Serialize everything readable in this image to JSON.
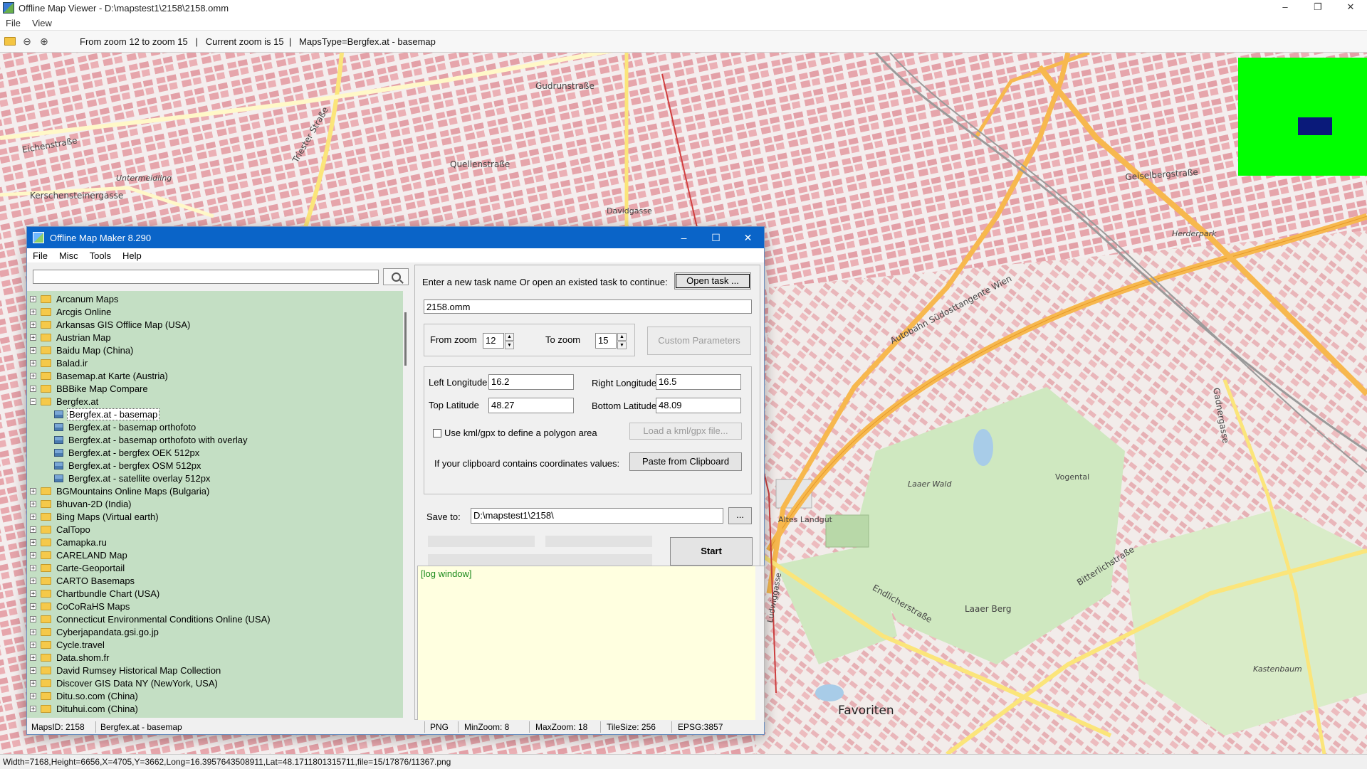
{
  "viewer": {
    "title": "Offline Map Viewer - D:\\mapstest1\\2158\\2158.omm",
    "menu": [
      "File",
      "View"
    ],
    "toolbar_status": "From zoom 12 to zoom 15   |   Current zoom is 15  |   MapsType=Bergfex.at - basemap",
    "status_bar": "Width=7168,Height=6656,X=4705,Y=3662,Long=16.3957643508911,Lat=48.1711801315711,file=15/17876/11367.png"
  },
  "map_labels": [
    "Favoriten",
    "Gudrunstraße",
    "Quellenstraße",
    "Laaer Berg",
    "Vogental",
    "Bitterlichstraße",
    "Endlicherstraße",
    "Eichenstraße",
    "Kerschensteinergasse",
    "Triester Straße",
    "Autobahn Südosttangente Wien",
    "Gadnergasse",
    "Laaer Wald",
    "Altes Landgut",
    "Kastenbaum",
    "Herderpark",
    "Geiselbergstraße",
    "Untermeidling",
    "Davidgasse",
    "Ludwiggasse"
  ],
  "dialog": {
    "title": "Offline Map Maker 8.290",
    "menu": [
      "File",
      "Misc",
      "Tools",
      "Help"
    ],
    "search_value": "",
    "tree": [
      {
        "label": "Arcanum Maps",
        "type": "folder",
        "expanded": false
      },
      {
        "label": "Arcgis Online",
        "type": "folder",
        "expanded": false
      },
      {
        "label": "Arkansas GIS Offlice Map (USA)",
        "type": "folder",
        "expanded": false
      },
      {
        "label": "Austrian Map",
        "type": "folder",
        "expanded": false
      },
      {
        "label": "Baidu Map (China)",
        "type": "folder",
        "expanded": false
      },
      {
        "label": "Balad.ir",
        "type": "folder",
        "expanded": false
      },
      {
        "label": "Basemap.at Karte (Austria)",
        "type": "folder",
        "expanded": false
      },
      {
        "label": "BBBike Map Compare",
        "type": "folder",
        "expanded": false
      },
      {
        "label": "Bergfex.at",
        "type": "folder",
        "expanded": true
      },
      {
        "label": "Bergfex.at - basemap",
        "type": "map",
        "selected": true
      },
      {
        "label": "Bergfex.at - basemap orthofoto",
        "type": "map"
      },
      {
        "label": "Bergfex.at - basemap orthofoto with overlay",
        "type": "map"
      },
      {
        "label": "Bergfex.at - bergfex OEK 512px",
        "type": "map"
      },
      {
        "label": "Bergfex.at - bergfex OSM 512px",
        "type": "map"
      },
      {
        "label": "Bergfex.at - satellite overlay 512px",
        "type": "map"
      },
      {
        "label": "BGMountains Online Maps (Bulgaria)",
        "type": "folder",
        "expanded": false
      },
      {
        "label": "Bhuvan-2D (India)",
        "type": "folder",
        "expanded": false
      },
      {
        "label": "Bing Maps (Virtual earth)",
        "type": "folder",
        "expanded": false
      },
      {
        "label": "CalTopo",
        "type": "folder",
        "expanded": false
      },
      {
        "label": "Camapka.ru",
        "type": "folder",
        "expanded": false
      },
      {
        "label": "CARELAND Map",
        "type": "folder",
        "expanded": false
      },
      {
        "label": "Carte-Geoportail",
        "type": "folder",
        "expanded": false
      },
      {
        "label": "CARTO Basemaps",
        "type": "folder",
        "expanded": false
      },
      {
        "label": "Chartbundle Chart (USA)",
        "type": "folder",
        "expanded": false
      },
      {
        "label": "CoCoRaHS Maps",
        "type": "folder",
        "expanded": false
      },
      {
        "label": "Connecticut Environmental Conditions Online (USA)",
        "type": "folder",
        "expanded": false
      },
      {
        "label": "Cyberjapandata.gsi.go.jp",
        "type": "folder",
        "expanded": false
      },
      {
        "label": "Cycle.travel",
        "type": "folder",
        "expanded": false
      },
      {
        "label": "Data.shom.fr",
        "type": "folder",
        "expanded": false
      },
      {
        "label": "David Rumsey Historical Map Collection",
        "type": "folder",
        "expanded": false
      },
      {
        "label": "Discover GIS Data NY (NewYork, USA)",
        "type": "folder",
        "expanded": false
      },
      {
        "label": "Ditu.so.com (China)",
        "type": "folder",
        "expanded": false
      },
      {
        "label": "Dituhui.com (China)",
        "type": "folder",
        "expanded": false
      }
    ],
    "task_prompt": "Enter a new task name Or open an existed task to continue:",
    "open_task_label": "Open task ...",
    "task_name": "2158.omm",
    "from_zoom_label": "From zoom",
    "from_zoom_value": "12",
    "to_zoom_label": "To zoom",
    "to_zoom_value": "15",
    "custom_params_label": "Custom Parameters",
    "left_lon_label": "Left Longitude",
    "left_lon_value": "16.2",
    "right_lon_label": "Right Longitude",
    "right_lon_value": "16.5",
    "top_lat_label": "Top Latitude",
    "top_lat_value": "48.27",
    "bottom_lat_label": "Bottom Latitude",
    "bottom_lat_value": "48.09",
    "kml_checkbox_label": "Use kml/gpx to define a polygon area",
    "kml_checked": false,
    "load_kml_label": "Load a kml/gpx file...",
    "clipboard_prompt": "If your clipboard contains coordinates values:",
    "paste_label": "Paste from Clipboard",
    "save_to_label": "Save to:",
    "save_to_value": "D:\\mapstest1\\2158\\",
    "browse_label": "...",
    "start_label": "Start",
    "log_text": "[log window]",
    "status": {
      "maps_id": "MapsID: 2158",
      "map_name": "Bergfex.at - basemap",
      "format": "PNG",
      "min_zoom": "MinZoom: 8",
      "max_zoom": "MaxZoom: 18",
      "tile_size": "TileSize: 256",
      "epsg": "EPSG:3857"
    }
  },
  "colors": {
    "dialog_title_bg": "#0a64c8",
    "tree_bg": "#c4dfc4",
    "log_bg": "#ffffe0",
    "log_text": "#1a8a1a",
    "overview_bg": "#00ff00",
    "overview_viewport": "#0a1a7a",
    "map_buildings": "#e8a8ae",
    "map_green": "#cfe8c0",
    "motorway": "#f7b84e"
  }
}
